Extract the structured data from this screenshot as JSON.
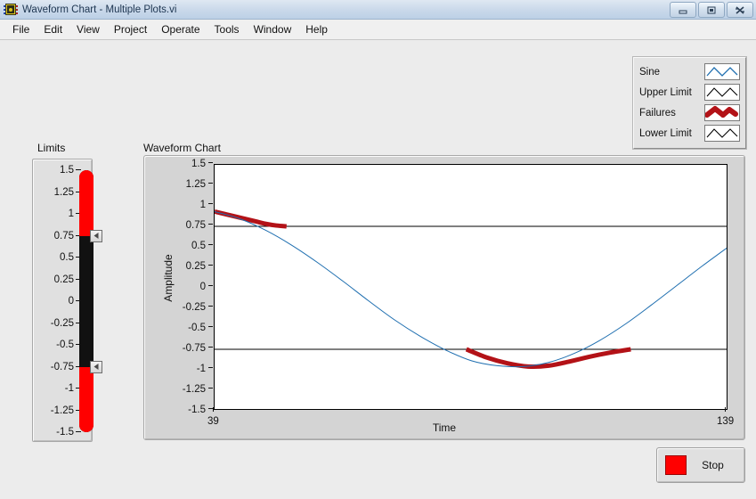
{
  "window": {
    "title": "Waveform Chart - Multiple Plots.vi",
    "icon": "labview-vi-icon",
    "buttons": [
      {
        "name": "minimize-button",
        "glyph": "minimize-icon"
      },
      {
        "name": "maximize-button",
        "glyph": "maximize-icon"
      },
      {
        "name": "close-button",
        "glyph": "close-icon"
      }
    ]
  },
  "menubar": {
    "items": [
      {
        "label": "File"
      },
      {
        "label": "Edit"
      },
      {
        "label": "View"
      },
      {
        "label": "Project"
      },
      {
        "label": "Operate"
      },
      {
        "label": "Tools"
      },
      {
        "label": "Window"
      },
      {
        "label": "Help"
      }
    ]
  },
  "legend": {
    "rows": [
      {
        "label": "Sine",
        "color": "#1f6fb0",
        "style": "zigzag-thin"
      },
      {
        "label": "Upper Limit",
        "color": "#000000",
        "style": "zigzag-thin"
      },
      {
        "label": "Failures",
        "color": "#b31217",
        "style": "zigzag-thick"
      },
      {
        "label": "Lower Limit",
        "color": "#000000",
        "style": "zigzag-thin"
      }
    ]
  },
  "limits": {
    "label": "Limits",
    "ticks": [
      "1.5",
      "1.25",
      "1",
      "0.75",
      "0.5",
      "0.25",
      "0",
      "-0.25",
      "-0.5",
      "-0.75",
      "-1",
      "-1.25",
      "-1.5"
    ],
    "min": -1.5,
    "max": 1.5,
    "upper_value": 0.75,
    "lower_value": -0.75,
    "fill_color": "#ff0000",
    "track_color": "#111111"
  },
  "chart": {
    "title": "Waveform Chart",
    "stop": {
      "label": "Stop",
      "led_color": "#ff0000"
    }
  },
  "chart_data": {
    "type": "line",
    "title": "Waveform Chart",
    "xlabel": "Time",
    "ylabel": "Amplitude",
    "xlim": [
      39,
      139
    ],
    "ylim": [
      -1.5,
      1.5
    ],
    "xticks": [
      39,
      139
    ],
    "yticks": [
      1.5,
      1.25,
      1,
      0.75,
      0.5,
      0.25,
      0,
      -0.25,
      -0.5,
      -0.75,
      -1,
      -1.25,
      -1.5
    ],
    "grid": false,
    "legend_position": "top-right-detached",
    "series": [
      {
        "name": "Sine",
        "color": "#1f6fb0",
        "width": 1,
        "x": [
          39,
          44,
          49,
          54,
          59,
          64,
          69,
          74,
          79,
          84,
          89,
          94,
          99,
          104,
          109,
          114,
          119,
          124,
          129,
          134,
          139
        ],
        "y": [
          0.93,
          0.84,
          0.7,
          0.52,
          0.31,
          0.08,
          -0.16,
          -0.39,
          -0.59,
          -0.76,
          -0.89,
          -0.95,
          -0.96,
          -0.91,
          -0.8,
          -0.64,
          -0.44,
          -0.21,
          0.03,
          0.27,
          0.5
        ]
      },
      {
        "name": "Upper Limit",
        "color": "#000000",
        "width": 1,
        "x": [
          39,
          139
        ],
        "y": [
          0.75,
          0.75
        ]
      },
      {
        "name": "Lower Limit",
        "color": "#000000",
        "width": 1,
        "x": [
          39,
          139
        ],
        "y": [
          -0.75,
          -0.75
        ]
      },
      {
        "name": "Failures",
        "color": "#b31217",
        "width": 5,
        "note": "overlay drawn only where |Sine| exceeds the limits",
        "segments": [
          {
            "x": [
              39,
              41,
              43,
              45,
              47,
              49,
              51,
              53
            ],
            "y": [
              0.93,
              0.9,
              0.87,
              0.84,
              0.81,
              0.78,
              0.76,
              0.75
            ]
          },
          {
            "x": [
              88,
              92,
              96,
              100,
              104,
              108,
              112,
              116,
              120
            ],
            "y": [
              -0.75,
              -0.85,
              -0.92,
              -0.96,
              -0.95,
              -0.9,
              -0.84,
              -0.79,
              -0.75
            ]
          }
        ]
      }
    ]
  }
}
